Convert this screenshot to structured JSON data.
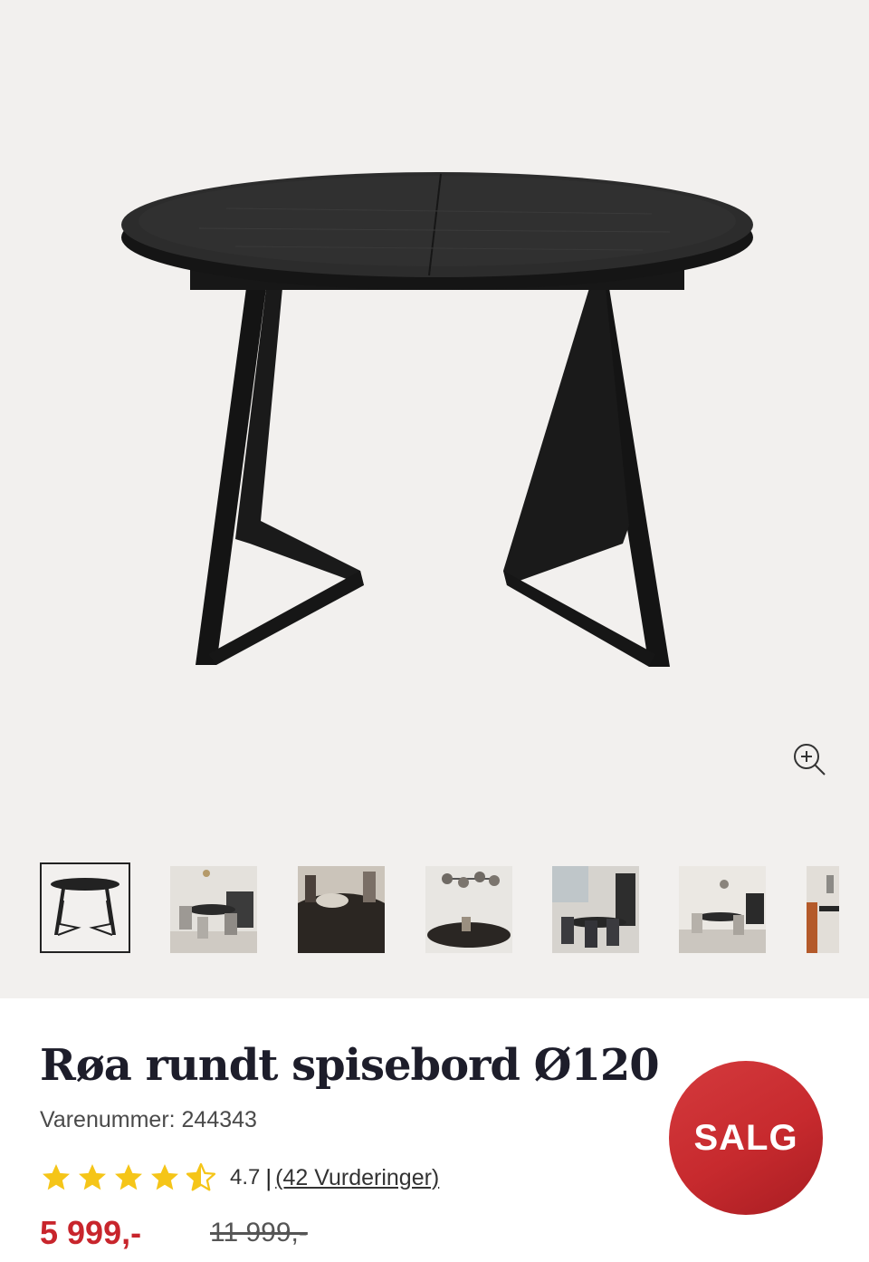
{
  "product": {
    "title": "Røa rundt spisebord Ø120",
    "sku_label": "Varenummer: 244343",
    "rating_value": "4.7",
    "rating_separator": "|",
    "reviews_label": "(42 Vurderinger)",
    "price": "5 999,-",
    "old_price": "11 999,-",
    "sale_badge": "SALG",
    "rating_stars": 4.5
  },
  "gallery": {
    "zoom_icon": "zoom-in-icon",
    "thumbnails": [
      {
        "alt": "table-product",
        "active": true
      },
      {
        "alt": "room-scene-1",
        "active": false
      },
      {
        "alt": "tabletop-detail",
        "active": false
      },
      {
        "alt": "pendant-lamp-scene",
        "active": false
      },
      {
        "alt": "dark-chairs-scene",
        "active": false
      },
      {
        "alt": "dining-room-scene",
        "active": false
      },
      {
        "alt": "orange-chair-scene",
        "active": false
      }
    ]
  },
  "colors": {
    "price_red": "#c8252c",
    "badge_red": "#c72a2e",
    "star_yellow": "#f5c518",
    "gallery_bg": "#f2f0ee"
  }
}
